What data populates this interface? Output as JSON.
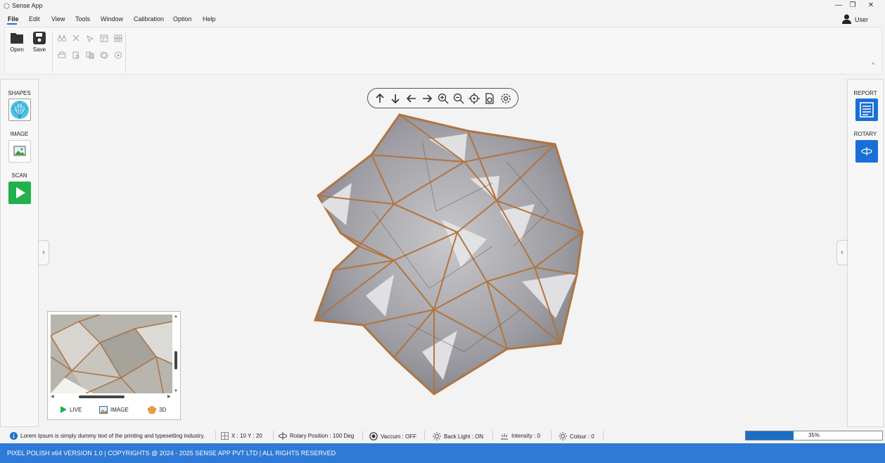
{
  "app": {
    "title": "Sense App"
  },
  "window_controls": {
    "minimize": "—",
    "restore": "❐",
    "close": "✕"
  },
  "menu": [
    "File",
    "Edit",
    "View",
    "Tools",
    "Window",
    "Calibration",
    "Option",
    "Help"
  ],
  "user": {
    "label": "User"
  },
  "ribbon": {
    "open_label": "Open",
    "save_label": "Save"
  },
  "left_panel": {
    "shapes_label": "SHAPES",
    "image_label": "IMAGE",
    "scan_label": "SCAN"
  },
  "right_panel": {
    "report_label": "REPORT",
    "rotary_label": "ROTARY"
  },
  "mini_view": {
    "live_label": "LIVE",
    "image_label": "IMAGE",
    "three_d_label": "3D"
  },
  "status": {
    "info_text": "Lorem Ipsum is simply dummy text of the printing and typesetting industry.",
    "xy_text": "X :  10   Y :  20",
    "rotary_text": "Rotary Position :  100 Deg",
    "vaccum_text": "Vaccum :  OFF",
    "backlight_text": "Back Light :  ON",
    "intensity_text": "Intensity :  0",
    "colour_text": "Colour :  0",
    "progress": 0.35,
    "progress_label": "35%"
  },
  "footer": {
    "text": "PIXEL POLISH  x64  VERSION  1.0  |  COPYRIGHTS @ 2024 - 2025 SENSE APP PVT LTD | ALL RIGHTS RESERVED"
  },
  "colors": {
    "accent": "#2e7ad6",
    "scan_green": "#22b14c",
    "progress_blue": "#1a6fc4"
  }
}
